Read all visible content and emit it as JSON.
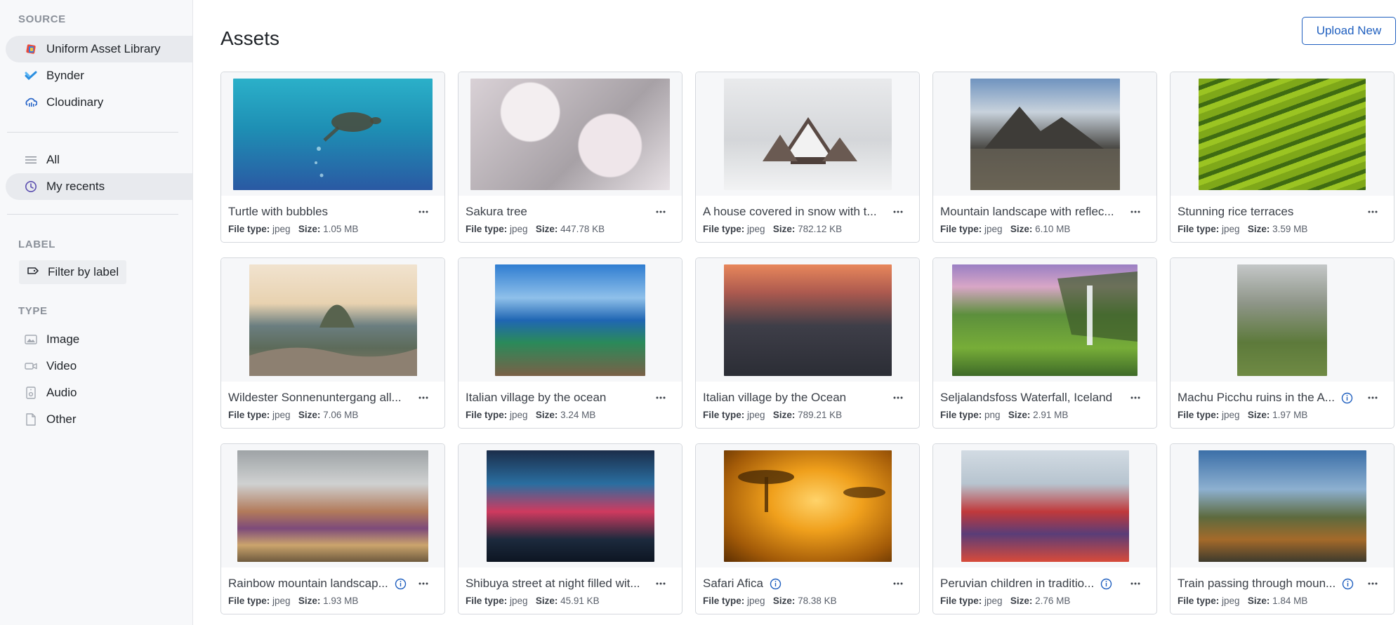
{
  "sidebar": {
    "source_title": "SOURCE",
    "sources": [
      {
        "label": "Uniform Asset Library",
        "icon": "uniform-logo-icon"
      },
      {
        "label": "Bynder",
        "icon": "bynder-logo-icon"
      },
      {
        "label": "Cloudinary",
        "icon": "cloudinary-logo-icon"
      }
    ],
    "views": [
      {
        "label": "All",
        "icon": "list-icon"
      },
      {
        "label": "My recents",
        "icon": "clock-icon"
      }
    ],
    "label_title": "LABEL",
    "filter_label": "Filter by label",
    "type_title": "TYPE",
    "types": [
      {
        "label": "Image",
        "icon": "image-icon"
      },
      {
        "label": "Video",
        "icon": "video-icon"
      },
      {
        "label": "Audio",
        "icon": "audio-icon"
      },
      {
        "label": "Other",
        "icon": "file-icon"
      }
    ]
  },
  "main": {
    "title": "Assets",
    "upload_label": "Upload New",
    "file_type_label": "File type:",
    "size_label": "Size:",
    "assets": [
      {
        "name": "Turtle with bubbles",
        "type": "jpeg",
        "size": "1.05 MB",
        "info": false
      },
      {
        "name": "Sakura tree",
        "type": "jpeg",
        "size": "447.78 KB",
        "info": false
      },
      {
        "name": "A house covered in snow with t...",
        "type": "jpeg",
        "size": "782.12 KB",
        "info": false
      },
      {
        "name": "Mountain landscape with reflec...",
        "type": "jpeg",
        "size": "6.10 MB",
        "info": false
      },
      {
        "name": "Stunning rice terraces",
        "type": "jpeg",
        "size": "3.59 MB",
        "info": false
      },
      {
        "name": "Wildester Sonnenuntergang all...",
        "type": "jpeg",
        "size": "7.06 MB",
        "info": false
      },
      {
        "name": "Italian village by the ocean",
        "type": "jpeg",
        "size": "3.24 MB",
        "info": false
      },
      {
        "name": "Italian village by the Ocean",
        "type": "jpeg",
        "size": "789.21 KB",
        "info": false
      },
      {
        "name": "Seljalandsfoss Waterfall, Iceland",
        "type": "png",
        "size": "2.91 MB",
        "info": false
      },
      {
        "name": "Machu Picchu ruins in the A...",
        "type": "jpeg",
        "size": "1.97 MB",
        "info": true
      },
      {
        "name": "Rainbow mountain landscap...",
        "type": "jpeg",
        "size": "1.93 MB",
        "info": true
      },
      {
        "name": "Shibuya street at night filled wit...",
        "type": "jpeg",
        "size": "45.91 KB",
        "info": false
      },
      {
        "name": "Safari Afica",
        "type": "jpeg",
        "size": "78.38 KB",
        "info": true
      },
      {
        "name": "Peruvian children in traditio...",
        "type": "jpeg",
        "size": "2.76 MB",
        "info": true
      },
      {
        "name": "Train passing through moun...",
        "type": "jpeg",
        "size": "1.84 MB",
        "info": true
      }
    ]
  },
  "colors": {
    "accent": "#1f5fbf",
    "sidebar_bg": "#f7f8fa",
    "active_bg": "#e8eaee"
  }
}
